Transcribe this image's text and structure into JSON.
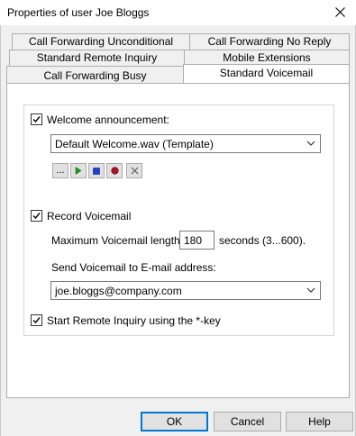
{
  "window": {
    "title": "Properties of user Joe Bloggs"
  },
  "tabs": {
    "row1": [
      "Call Forwarding Unconditional",
      "Call Forwarding No Reply"
    ],
    "row2": [
      "Standard Remote Inquiry",
      "Mobile Extensions"
    ],
    "row3": [
      "Call Forwarding Busy",
      "Standard Voicemail"
    ],
    "active": "Standard Voicemail"
  },
  "voicemail": {
    "welcome_label": "Welcome announcement:",
    "welcome_checked": true,
    "welcome_file": "Default Welcome.wav (Template)",
    "player_icons": [
      "ellipsis-icon",
      "play-icon",
      "stop-icon",
      "record-icon",
      "close-icon"
    ],
    "ellipsis_text": "...",
    "record_label": "Record Voicemail",
    "record_checked": true,
    "max_length_label": "Maximum Voicemail length",
    "max_length_value": "180",
    "max_length_unit": "seconds (3...600).",
    "send_email_label": "Send Voicemail to E-mail address:",
    "email_value": "joe.bloggs@company.com",
    "remote_inquiry_label": "Start Remote Inquiry using the *-key",
    "remote_inquiry_checked": true
  },
  "buttons": {
    "ok": "OK",
    "cancel": "Cancel",
    "help": "Help"
  },
  "colors": {
    "play": "#1a9a1a",
    "stop": "#1f3fd0",
    "record": "#a8122a",
    "accent": "#0078d7"
  }
}
